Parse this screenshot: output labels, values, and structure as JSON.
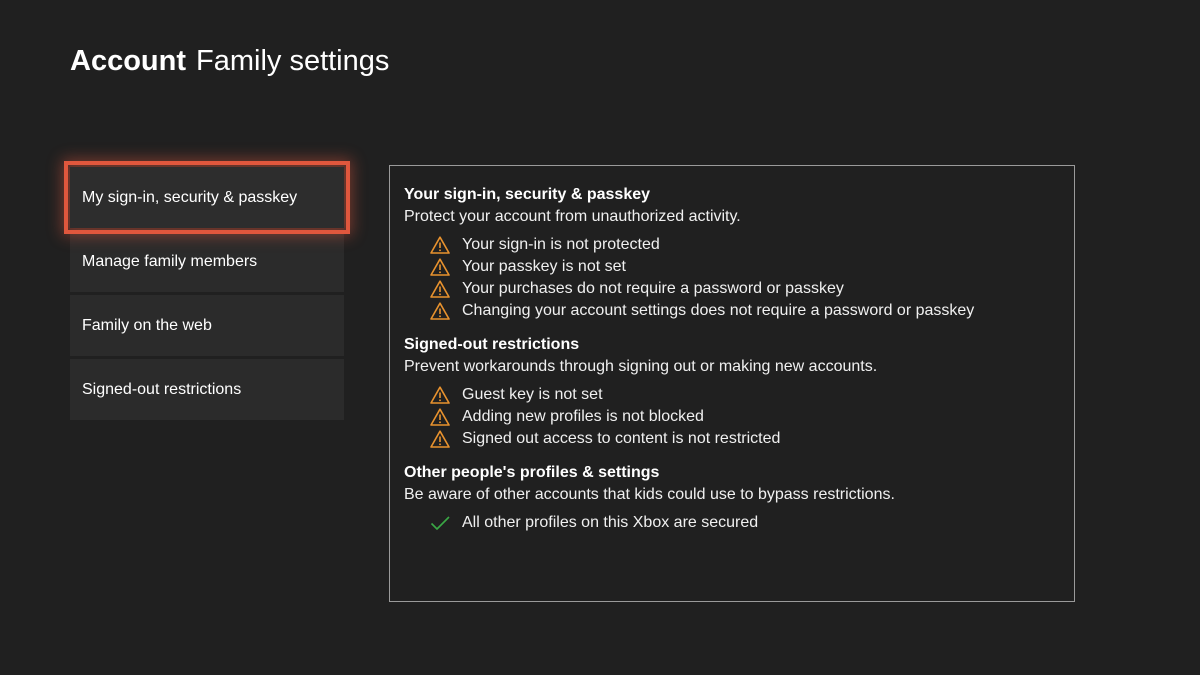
{
  "header": {
    "section": "Account",
    "title": "Family settings"
  },
  "menu": [
    {
      "label": "My sign-in, security & passkey",
      "selected": true
    },
    {
      "label": "Manage family members",
      "selected": false
    },
    {
      "label": "Family on the web",
      "selected": false
    },
    {
      "label": "Signed-out restrictions",
      "selected": false
    }
  ],
  "panel": {
    "sections": [
      {
        "title": "Your sign-in, security & passkey",
        "description": "Protect your account from unauthorized activity.",
        "items": [
          {
            "icon": "warning-icon",
            "text": "Your sign-in is not protected"
          },
          {
            "icon": "warning-icon",
            "text": "Your passkey is not set"
          },
          {
            "icon": "warning-icon",
            "text": "Your purchases do not require a password or passkey"
          },
          {
            "icon": "warning-icon",
            "text": "Changing your account settings does not require a password or passkey"
          }
        ]
      },
      {
        "title": "Signed-out restrictions",
        "description": "Prevent workarounds through signing out or making new accounts.",
        "items": [
          {
            "icon": "warning-icon",
            "text": "Guest key is not set"
          },
          {
            "icon": "warning-icon",
            "text": "Adding new profiles is not blocked"
          },
          {
            "icon": "warning-icon",
            "text": "Signed out access to content is not restricted"
          }
        ]
      },
      {
        "title": "Other people's profiles & settings",
        "description": "Be aware of other accounts that kids could use to bypass restrictions.",
        "items": [
          {
            "icon": "checkmark-icon",
            "text": "All other profiles on this Xbox are secured"
          }
        ]
      }
    ]
  },
  "colors": {
    "background": "#202020",
    "focus": "#e0573d",
    "warning": "#e8922e",
    "success": "#3aa845"
  }
}
